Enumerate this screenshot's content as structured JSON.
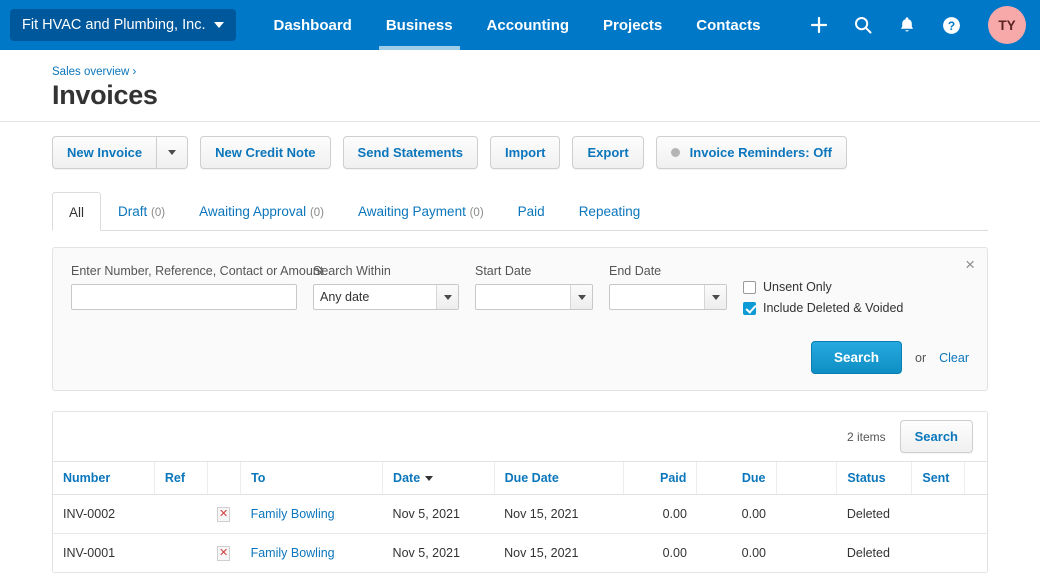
{
  "topnav": {
    "org_name": "Fit HVAC and Plumbing, Inc.",
    "links": [
      {
        "label": "Dashboard",
        "active": false
      },
      {
        "label": "Business",
        "active": true
      },
      {
        "label": "Accounting",
        "active": false
      },
      {
        "label": "Projects",
        "active": false
      },
      {
        "label": "Contacts",
        "active": false
      }
    ],
    "icons": [
      "plus-icon",
      "search-icon",
      "bell-icon",
      "help-icon"
    ],
    "avatar_initials": "TY",
    "avatar_color": "#f7a8a8",
    "bar_color": "#0078c8",
    "org_color": "#00589c"
  },
  "page": {
    "breadcrumb": "Sales overview ›",
    "title": "Invoices"
  },
  "toolbar": {
    "new_invoice": "New Invoice",
    "new_credit_note": "New Credit Note",
    "send_statements": "Send Statements",
    "import": "Import",
    "export": "Export",
    "reminders": "Invoice Reminders: Off"
  },
  "tabs": [
    {
      "label": "All",
      "count": "",
      "active": true
    },
    {
      "label": "Draft",
      "count": "(0)",
      "active": false
    },
    {
      "label": "Awaiting Approval",
      "count": "(0)",
      "active": false
    },
    {
      "label": "Awaiting Payment",
      "count": "(0)",
      "active": false
    },
    {
      "label": "Paid",
      "count": "",
      "active": false
    },
    {
      "label": "Repeating",
      "count": "",
      "active": false
    }
  ],
  "search_panel": {
    "query_label": "Enter Number, Reference, Contact or Amount",
    "query_value": "",
    "within_label": "Search Within",
    "within_value": "Any date",
    "start_label": "Start Date",
    "start_value": "",
    "end_label": "End Date",
    "end_value": "",
    "unsent_label": "Unsent Only",
    "unsent_checked": false,
    "deleted_label": "Include Deleted & Voided",
    "deleted_checked": true,
    "search_button": "Search",
    "or_text": "or",
    "clear_link": "Clear",
    "close_icon": "×"
  },
  "results": {
    "items_count": "2 items",
    "search_button": "Search",
    "columns": [
      {
        "label": "Number",
        "align": "left"
      },
      {
        "label": "Ref",
        "align": "left"
      },
      {
        "label": "",
        "align": "left"
      },
      {
        "label": "To",
        "align": "left"
      },
      {
        "label": "Date",
        "align": "left",
        "sorted": true
      },
      {
        "label": "Due Date",
        "align": "left"
      },
      {
        "label": "Paid",
        "align": "right"
      },
      {
        "label": "Due",
        "align": "right"
      },
      {
        "label": "",
        "align": "left"
      },
      {
        "label": "Status",
        "align": "left"
      },
      {
        "label": "Sent",
        "align": "left"
      },
      {
        "label": "",
        "align": "left"
      }
    ],
    "rows": [
      {
        "number": "INV-0002",
        "ref": "",
        "flag": "deleted-document-icon",
        "to": "Family Bowling",
        "date": "Nov 5, 2021",
        "due_date": "Nov 15, 2021",
        "paid": "0.00",
        "due": "0.00",
        "blank": "",
        "status": "Deleted",
        "sent": "",
        "trailing": ""
      },
      {
        "number": "INV-0001",
        "ref": "",
        "flag": "deleted-document-icon",
        "to": "Family Bowling",
        "date": "Nov 5, 2021",
        "due_date": "Nov 15, 2021",
        "paid": "0.00",
        "due": "0.00",
        "blank": "",
        "status": "Deleted",
        "sent": "",
        "trailing": ""
      }
    ]
  }
}
